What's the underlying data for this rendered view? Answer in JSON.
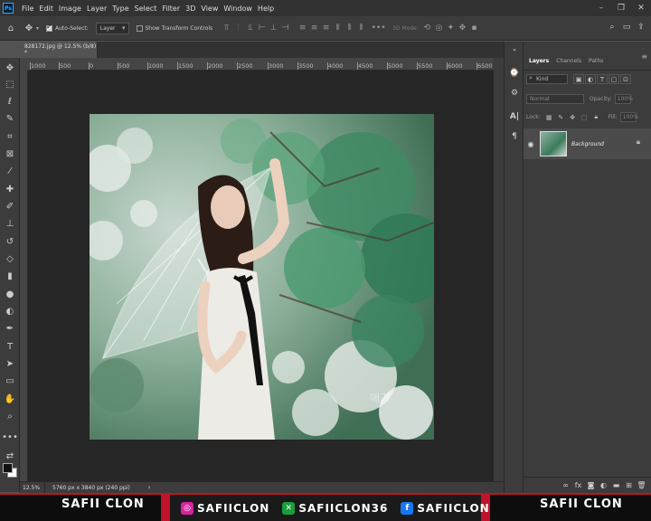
{
  "menubar": {
    "logo": "Ps",
    "items": [
      "File",
      "Edit",
      "Image",
      "Layer",
      "Type",
      "Select",
      "Filter",
      "3D",
      "View",
      "Window",
      "Help"
    ],
    "window_controls": [
      "–",
      "❐",
      "✕"
    ]
  },
  "options": {
    "auto_select_label": "Auto-Select:",
    "auto_select_checked": true,
    "target_value": "Layer",
    "show_transform_label": "Show Transform Controls",
    "show_transform_checked": false,
    "mode_3d_label": "3D Mode:"
  },
  "document": {
    "tab_title": "828172.jpg @ 12.5% (b/8) *",
    "zoom": "12.5%",
    "info": "5760 px x 3840 px (240 ppi)"
  },
  "ruler": {
    "h_ticks": [
      "1000",
      "500",
      "0",
      "500",
      "1000",
      "1500",
      "2000",
      "2500",
      "3000",
      "3500",
      "4000",
      "4500",
      "5000",
      "5500",
      "6000",
      "6500"
    ]
  },
  "layers_panel": {
    "tabs": [
      "Layers",
      "Channels",
      "Paths"
    ],
    "active_tab": "Layers",
    "filter_label": "Kind",
    "blend_mode": "Normal",
    "opacity_label": "Opacity:",
    "opacity_value": "100%",
    "lock_label": "Lock:",
    "fill_label": "Fill:",
    "fill_value": "100%",
    "layers": [
      {
        "name": "Background",
        "visible": true,
        "locked": true
      }
    ]
  },
  "banner": {
    "left_text": "SAFII CLON",
    "right_text": "SAFII CLON",
    "socials": [
      {
        "network": "instagram",
        "handle": "SAFIICLON",
        "color": "#d6249f"
      },
      {
        "network": "xbox",
        "handle": "SAFIICLON36",
        "color": "#1a9e3a"
      },
      {
        "network": "facebook",
        "handle": "SAFIICLON",
        "color": "#1877f2"
      }
    ],
    "accent_color": "#c0132a"
  }
}
